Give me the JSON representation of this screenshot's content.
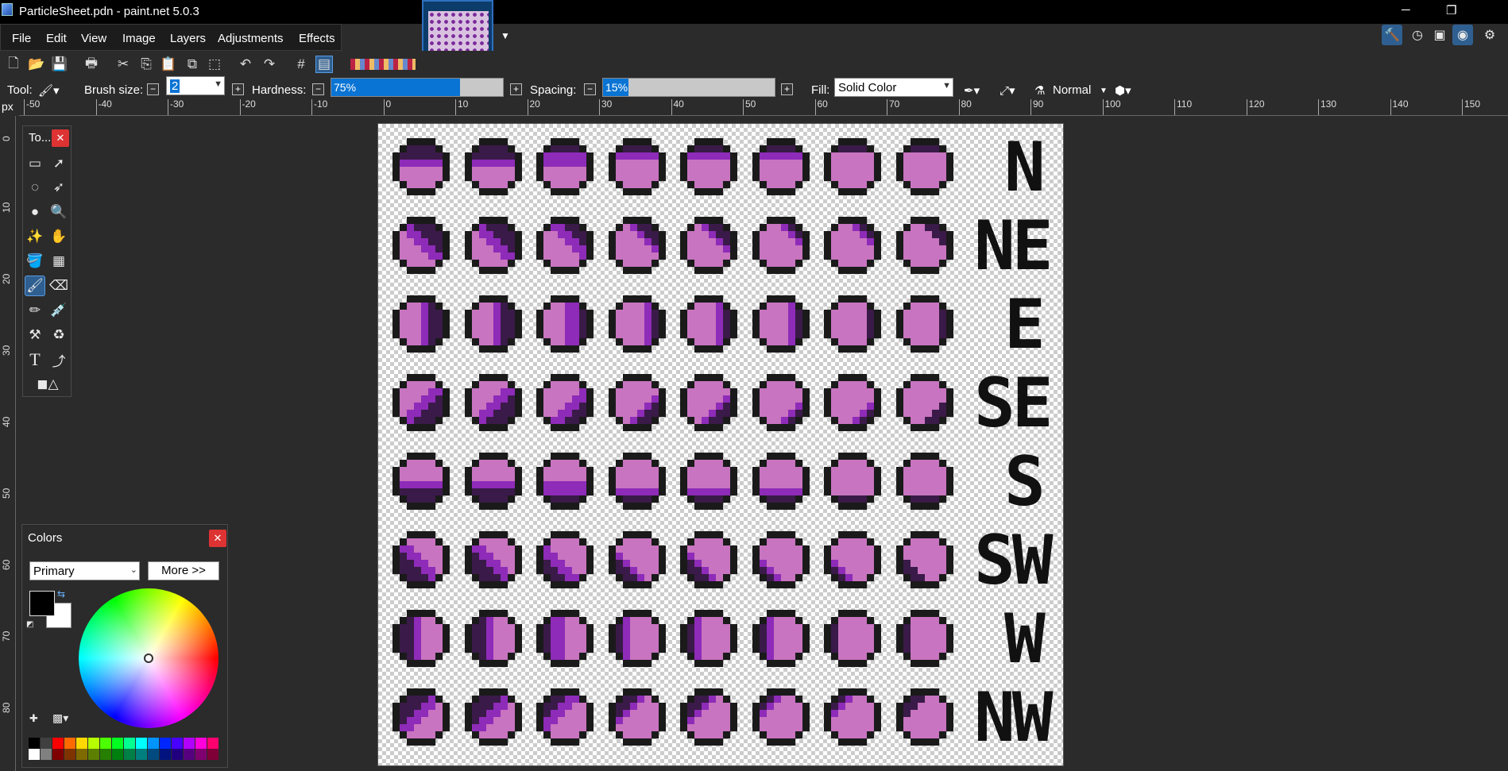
{
  "window": {
    "title": "ParticleSheet.pdn - paint.net 5.0.3",
    "minimize": "─",
    "restore": "❐",
    "close": "✕"
  },
  "menu": [
    "File",
    "Edit",
    "View",
    "Image",
    "Layers",
    "Adjustments",
    "Effects"
  ],
  "toolbar": {
    "tool_label": "Tool:",
    "brush_size_label": "Brush size:",
    "brush_size_value": "2",
    "hardness_label": "Hardness:",
    "hardness_value": "75%",
    "hardness_fraction": 0.75,
    "spacing_label": "Spacing:",
    "spacing_value": "15%",
    "spacing_fraction": 0.15,
    "fill_label": "Fill:",
    "fill_value": "Solid Color",
    "blend_mode": "Normal"
  },
  "ruler": {
    "unit": "px",
    "ticks": [
      "-50",
      "-40",
      "-30",
      "-20",
      "-10",
      "0",
      "10",
      "20",
      "30",
      "40",
      "50",
      "60",
      "70",
      "80",
      "90",
      "100",
      "110",
      "120",
      "130",
      "140",
      "150"
    ],
    "vticks": [
      "0",
      "10",
      "20",
      "30",
      "40",
      "50",
      "60",
      "70",
      "80"
    ]
  },
  "tools_panel": {
    "title": "To...",
    "close": "✕"
  },
  "colors_panel": {
    "title": "Colors",
    "close": "✕",
    "mode": "Primary",
    "more_button": "More >>",
    "primary": "#000000",
    "secondary": "#ffffff"
  },
  "palette": [
    "#000000",
    "#404040",
    "#ff0000",
    "#ff6a00",
    "#ffd800",
    "#b6ff00",
    "#4cff00",
    "#00ff21",
    "#00ff90",
    "#00ffff",
    "#0094ff",
    "#0026ff",
    "#4800ff",
    "#b200ff",
    "#ff00dc",
    "#ff006e"
  ],
  "palette2": [
    "#ffffff",
    "#808080",
    "#7f0000",
    "#7f3300",
    "#7f6a00",
    "#5b7f00",
    "#267f00",
    "#007f0e",
    "#007f46",
    "#007f7f",
    "#004a7f",
    "#00137f",
    "#21007f",
    "#57007f",
    "#7f006e",
    "#7f0037"
  ],
  "canvas": {
    "directions": [
      "N",
      "NE",
      "E",
      "SE",
      "S",
      "SW",
      "W",
      "NW"
    ],
    "colors": {
      "light": "#c874c0",
      "mid": "#8e2bb8",
      "dark": "#3a1a48",
      "outline": "#1a1a1a"
    }
  }
}
